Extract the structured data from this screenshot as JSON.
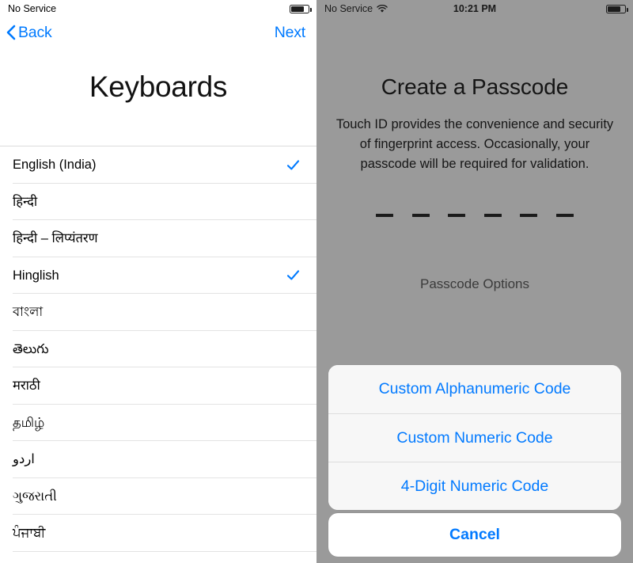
{
  "left": {
    "status_bar": {
      "carrier": "No Service",
      "battery_icon": "battery-icon"
    },
    "nav": {
      "back_label": "Back",
      "back_icon": "chevron-left-icon",
      "next_label": "Next"
    },
    "title": "Keyboards",
    "keyboards": [
      {
        "label": "English (India)",
        "checked": true
      },
      {
        "label": "हिन्दी",
        "checked": false
      },
      {
        "label": "हिन्दी – लिप्यंतरण",
        "checked": false
      },
      {
        "label": "Hinglish",
        "checked": true
      },
      {
        "label": "বাংলা",
        "checked": false
      },
      {
        "label": "తెలుగు",
        "checked": false
      },
      {
        "label": "मराठी",
        "checked": false
      },
      {
        "label": "தமிழ்",
        "checked": false
      },
      {
        "label": "اردو",
        "checked": false
      },
      {
        "label": "ગુજરાતી",
        "checked": false
      },
      {
        "label": "ਪੰਜਾਬੀ",
        "checked": false
      }
    ],
    "accent_color": "#007aff",
    "checkmark_icon": "check-icon"
  },
  "right": {
    "status_bar": {
      "carrier": "No Service",
      "wifi_icon": "wifi-icon",
      "time": "10:21 PM",
      "battery_icon": "battery-icon"
    },
    "title": "Create a Passcode",
    "description": "Touch ID provides the convenience and security of fingerprint access. Occasionally, your passcode will be required for validation.",
    "passcode_field": {
      "digits": 6,
      "entered": 0
    },
    "passcode_options_label": "Passcode Options",
    "action_sheet": {
      "options": [
        "Custom Alphanumeric Code",
        "Custom Numeric Code",
        "4-Digit Numeric Code"
      ],
      "cancel_label": "Cancel"
    },
    "dim_color": "#9a9a9a",
    "accent_color": "#027aff"
  }
}
